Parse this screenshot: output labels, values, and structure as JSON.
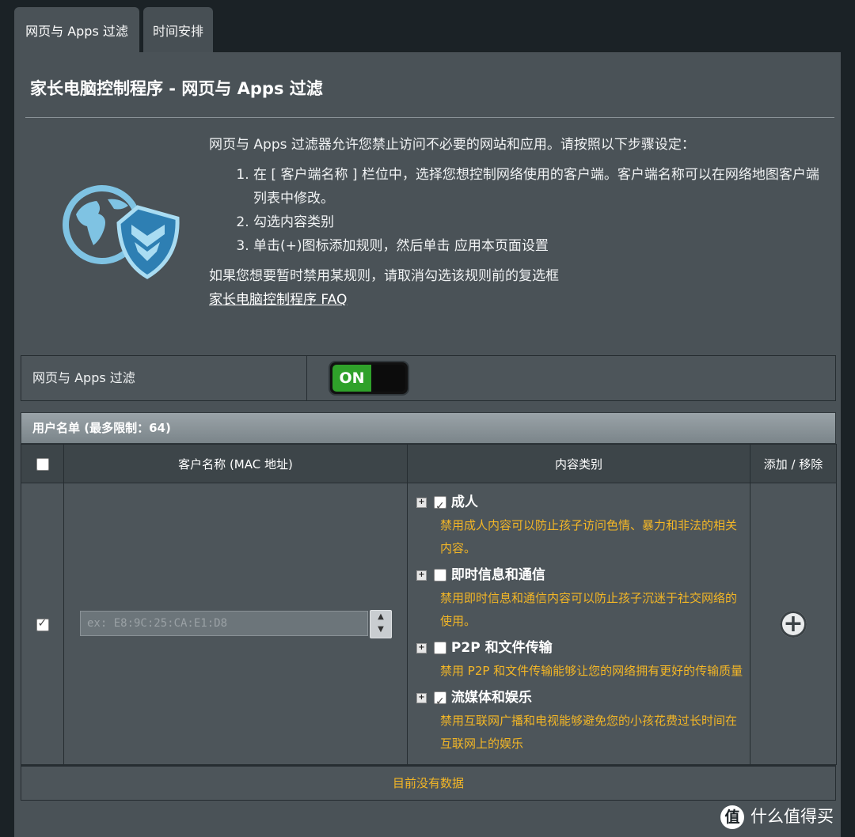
{
  "tabs": [
    {
      "label": "网页与 Apps 过滤"
    },
    {
      "label": "时间安排"
    }
  ],
  "panel": {
    "title": "家长电脑控制程序 - 网页与 Apps 过滤",
    "intro": "网页与 Apps 过滤器允许您禁止访问不必要的网站和应用。请按照以下步骤设定：",
    "steps": [
      "在 [ 客户端名称 ] 栏位中，选择您想控制网络使用的客户端。客户端名称可以在网络地图客户端列表中修改。",
      "勾选内容类别",
      "单击(+)图标添加规则，然后单击 应用本页面设置"
    ],
    "disable_hint": "如果您想要暂时禁用某规则，请取消勾选该规则前的复选框",
    "faq_link": "家长电脑控制程序 FAQ"
  },
  "toggle": {
    "label": "网页与 Apps 过滤",
    "state": "ON"
  },
  "list": {
    "header": "用户名单 (最多限制：64)",
    "columns": [
      "客户名称 (MAC 地址)",
      "内容类别",
      "添加 / 移除"
    ],
    "row": {
      "enabled": true,
      "mac_placeholder": "ex: E8:9C:25:CA:E1:D8",
      "categories": [
        {
          "name": "成人",
          "checked": true,
          "desc": "禁用成人内容可以防止孩子访问色情、暴力和非法的相关内容。"
        },
        {
          "name": "即时信息和通信",
          "checked": false,
          "desc": "禁用即时信息和通信内容可以防止孩子沉迷于社交网络的使用。"
        },
        {
          "name": "P2P 和文件传输",
          "checked": false,
          "desc": "禁用 P2P 和文件传输能够让您的网络拥有更好的传输质量"
        },
        {
          "name": "流媒体和娱乐",
          "checked": true,
          "desc": "禁用互联网广播和电视能够避免您的小孩花费过长时间在互联网上的娱乐"
        }
      ]
    },
    "empty_text": "目前没有数据"
  },
  "watermark": {
    "text": "什么值得买",
    "icon_glyph": "值"
  }
}
